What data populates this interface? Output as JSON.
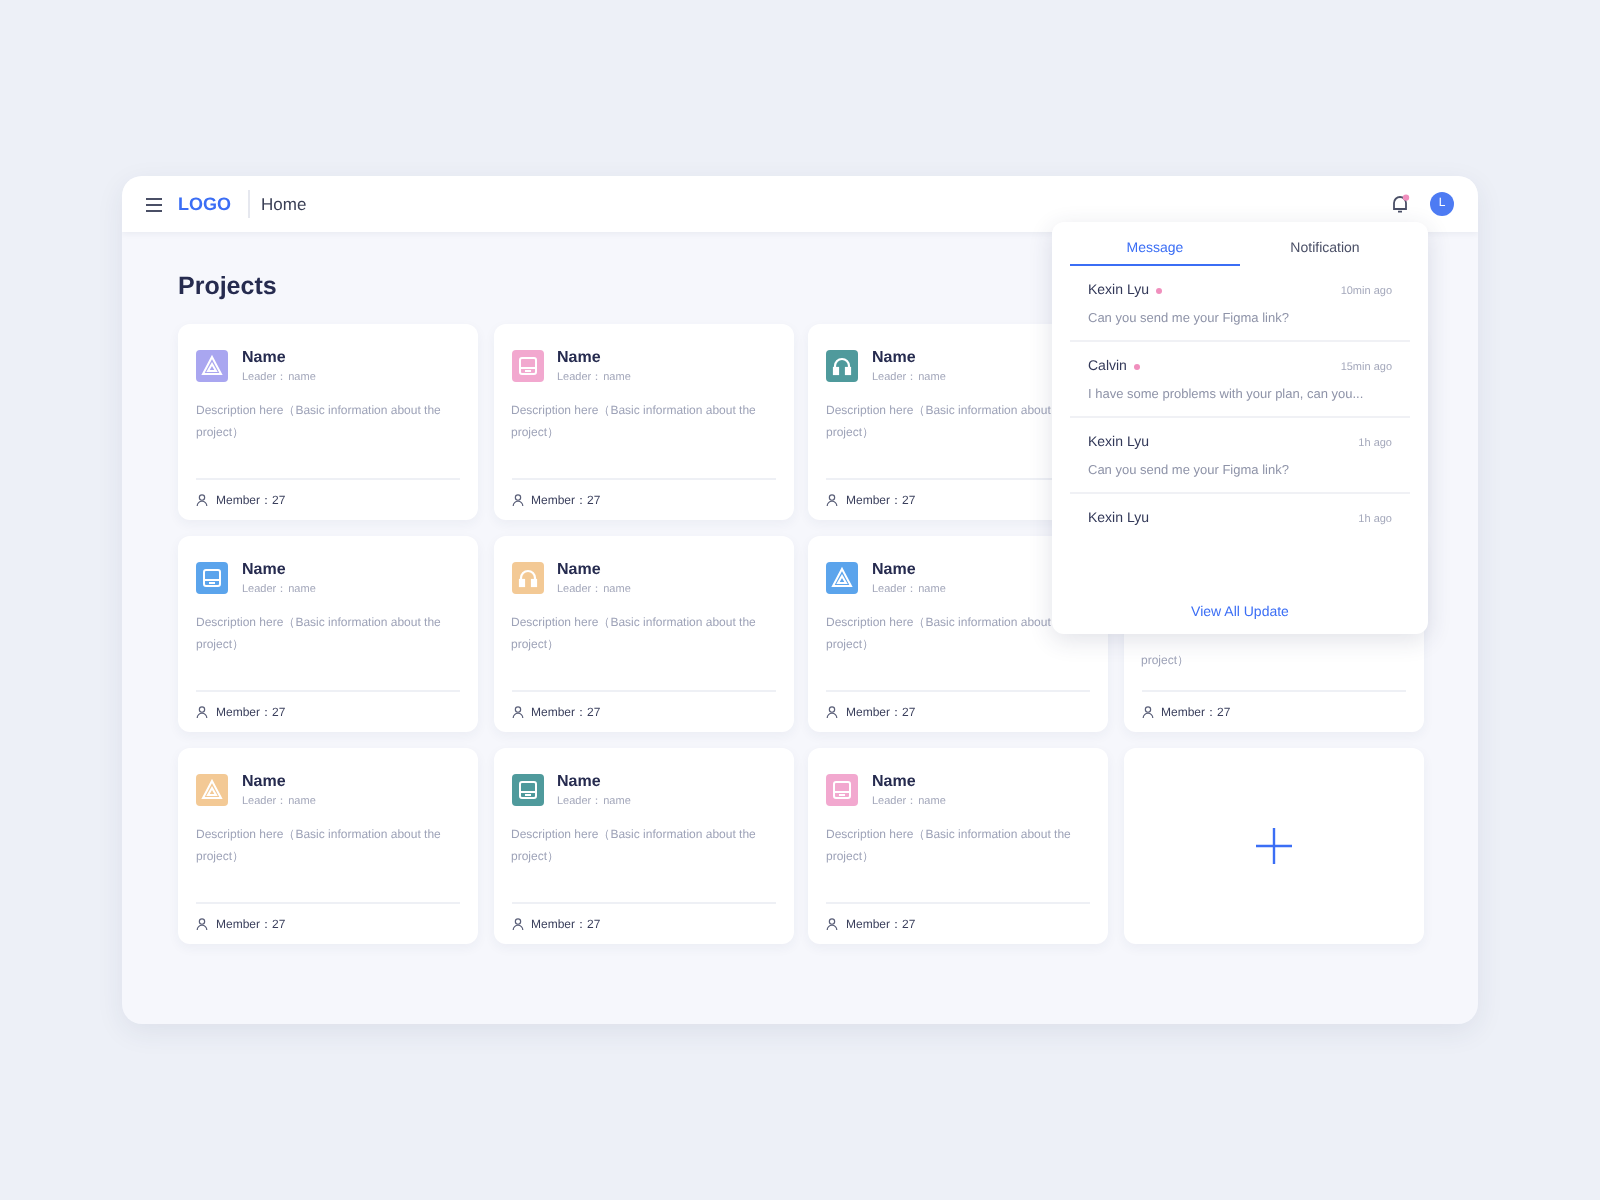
{
  "header": {
    "logo": "LOGO",
    "breadcrumb": "Home",
    "avatar_initial": "L",
    "bell_unread": true
  },
  "page_title": "Projects",
  "cards": [
    {
      "kind": "triangle",
      "color": "#a9a6f0",
      "name": "Name",
      "leader": "Leader：name",
      "description_lines": [
        "Description here（Basic information about the",
        "project）"
      ],
      "member": "Member：27"
    },
    {
      "kind": "monitor",
      "color": "#f2a8cf",
      "name": "Name",
      "leader": "Leader：name",
      "description_lines": [
        "Description here（Basic information about the",
        "project）"
      ],
      "member": "Member：27"
    },
    {
      "kind": "headphones",
      "color": "#4f9a9c",
      "name": "Name",
      "leader": "Leader：name",
      "description_lines": [
        "Description here（Basic information about",
        "project）"
      ],
      "member": "Member：27"
    },
    {
      "kind": "hidden"
    },
    {
      "kind": "monitor",
      "color": "#5ba4ec",
      "name": "Name",
      "leader": "Leader：name",
      "description_lines": [
        "Description here（Basic information about the",
        "project）"
      ],
      "member": "Member：27"
    },
    {
      "kind": "headphones",
      "color": "#f3c995",
      "name": "Name",
      "leader": "Leader：name",
      "description_lines": [
        "Description here（Basic information about the",
        "project）"
      ],
      "member": "Member：27"
    },
    {
      "kind": "triangle",
      "color": "#5ba4ec",
      "name": "Name",
      "leader": "Leader：name",
      "description_lines": [
        "Description here（Basic information about",
        "project）"
      ],
      "member": "Member：27"
    },
    {
      "kind": "covered",
      "description_lines": [
        "project）"
      ],
      "member": "Member：27"
    },
    {
      "kind": "triangle",
      "color": "#f3c995",
      "name": "Name",
      "leader": "Leader：name",
      "description_lines": [
        "Description here（Basic information about the",
        "project）"
      ],
      "member": "Member：27"
    },
    {
      "kind": "monitor",
      "color": "#4f9a9c",
      "name": "Name",
      "leader": "Leader：name",
      "description_lines": [
        "Description here（Basic information about the",
        "project）"
      ],
      "member": "Member：27"
    },
    {
      "kind": "monitor",
      "color": "#f2a8cf",
      "name": "Name",
      "leader": "Leader：name",
      "description_lines": [
        "Description here（Basic information about the",
        "project）"
      ],
      "member": "Member：27"
    },
    {
      "kind": "add"
    }
  ],
  "popover": {
    "tabs": [
      {
        "label": "Message",
        "selected": true
      },
      {
        "label": "Notification",
        "selected": false
      }
    ],
    "messages": [
      {
        "sender": "Kexin Lyu",
        "unread": true,
        "time": "10min ago",
        "preview": "Can you send me your Figma link?"
      },
      {
        "sender": "Calvin",
        "unread": true,
        "time": "15min ago",
        "preview": "I have some problems with your plan, can you..."
      },
      {
        "sender": "Kexin Lyu",
        "unread": false,
        "time": "1h ago",
        "preview": "Can you send me your Figma link?"
      },
      {
        "sender": "Kexin Lyu",
        "unread": false,
        "time": "1h ago"
      }
    ],
    "footer_link": "View All Update"
  }
}
